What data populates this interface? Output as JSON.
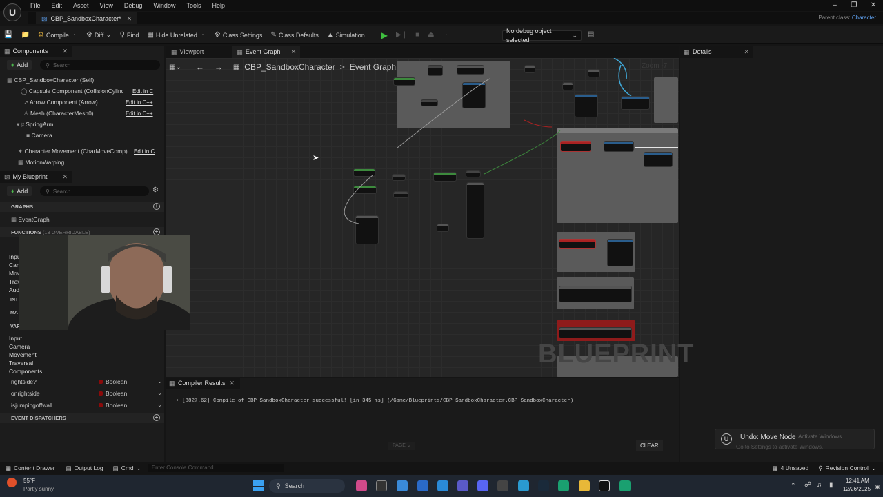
{
  "menu": [
    "File",
    "Edit",
    "Asset",
    "View",
    "Debug",
    "Window",
    "Tools",
    "Help"
  ],
  "doc_tab": "CBP_SandboxCharacter*",
  "parent_class": {
    "label": "Parent class:",
    "value": "Character"
  },
  "toolbar": {
    "compile": "Compile",
    "diff": "Diff",
    "find": "Find",
    "hide_unrelated": "Hide Unrelated",
    "class_settings": "Class Settings",
    "class_defaults": "Class Defaults",
    "simulation": "Simulation",
    "debug_object": "No debug object selected"
  },
  "components_panel": {
    "tab": "Components",
    "add": "Add",
    "search_placeholder": "Search",
    "items": [
      {
        "name": "CBP_SandboxCharacter (Self)",
        "edit": ""
      },
      {
        "name": "Capsule Component (CollisionCylinder)",
        "edit": "Edit in C"
      },
      {
        "name": "Arrow Component (Arrow)",
        "edit": "Edit in C++"
      },
      {
        "name": "Mesh (CharacterMesh0)",
        "edit": "Edit in C++"
      },
      {
        "name": "SpringArm",
        "edit": ""
      },
      {
        "name": "Camera",
        "edit": ""
      },
      {
        "name": "Character Movement (CharMoveComp)",
        "edit": "Edit in C"
      },
      {
        "name": "MotionWarping",
        "edit": ""
      }
    ]
  },
  "my_blueprint": {
    "tab": "My Blueprint",
    "add": "Add",
    "search_placeholder": "Search",
    "graphs_header": "GRAPHS",
    "event_graph": "EventGraph",
    "functions_header": "FUNCTIONS",
    "functions_count": "(13 OVERRIDABLE)",
    "partial_labels": [
      "Inpu",
      "Cam",
      "Mov",
      "Trav",
      "Aud",
      "INT",
      "MA",
      "VAF"
    ],
    "var_categories": [
      "Input",
      "Camera",
      "Movement",
      "Traversal",
      "Components"
    ],
    "variables": [
      {
        "name": "rightside?",
        "type": "Boolean"
      },
      {
        "name": "onrightside",
        "type": "Boolean"
      },
      {
        "name": "isjumpingoffwall",
        "type": "Boolean"
      }
    ],
    "event_dispatchers": "EVENT DISPATCHERS"
  },
  "graph": {
    "viewport_tab": "Viewport",
    "event_graph_tab": "Event Graph",
    "breadcrumb_root": "CBP_SandboxCharacter",
    "breadcrumb_sep": ">",
    "breadcrumb_current": "Event Graph",
    "zoom": "Zoom -7",
    "watermark": "BLUEPRINT"
  },
  "details_tab": "Details",
  "compiler": {
    "tab": "Compiler Results",
    "message": "[8827.62] Compile of CBP_SandboxCharacter successful! [in 345 ms] (/Game/Blueprints/CBP_SandboxCharacter.CBP_SandboxCharacter)",
    "page": "PAGE",
    "clear": "CLEAR"
  },
  "notification": {
    "title": "Undo: Move Node",
    "activate": "Activate Windows",
    "activate_sub": "Go to Settings to activate Windows."
  },
  "statusbar": {
    "content_drawer": "Content Drawer",
    "output_log": "Output Log",
    "cmd": "Cmd",
    "console_placeholder": "Enter Console Command",
    "unsaved": "4 Unsaved",
    "revision": "Revision Control"
  },
  "taskbar": {
    "weather_temp": "55°F",
    "weather_desc": "Partly sunny",
    "search": "Search",
    "time": "12:41 AM",
    "date": "12/26/2025"
  }
}
